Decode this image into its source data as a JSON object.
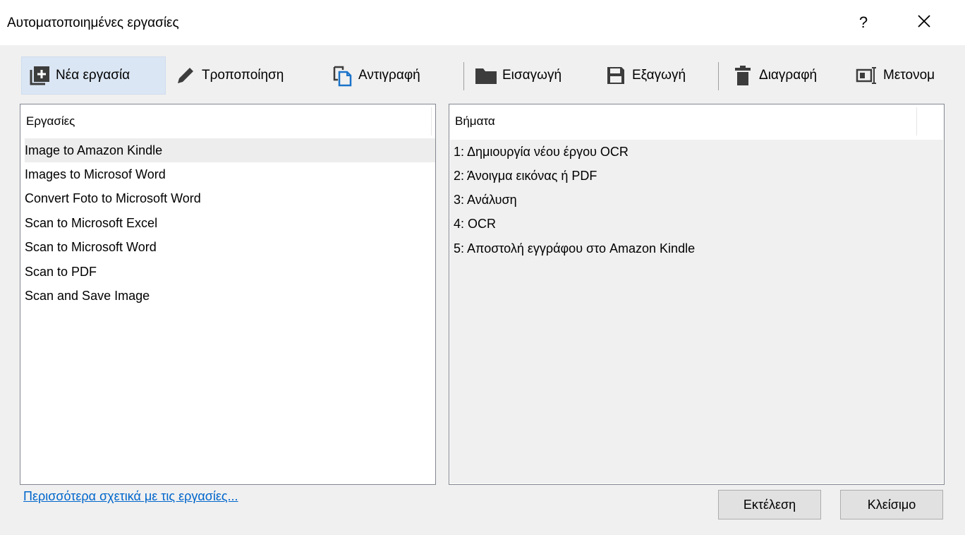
{
  "window": {
    "title": "Αυτοματοποιημένες εργασίες",
    "help_label": "?",
    "close_label": "✕"
  },
  "toolbar": {
    "new_task": "Νέα εργασία",
    "modify": "Τροποποίηση",
    "copy": "Αντιγραφή",
    "import": "Εισαγωγή",
    "export": "Εξαγωγή",
    "delete": "Διαγραφή",
    "rename": "Μετονομ"
  },
  "tasks": {
    "header": "Εργασίες",
    "items": [
      "Image to Amazon Kindle",
      "Images to Microsof Word",
      "Convert Foto to Microsoft Word",
      "Scan to Microsoft Excel",
      "Scan to Microsoft Word",
      "Scan to PDF",
      "Scan and Save Image"
    ],
    "selected_index": 0
  },
  "steps": {
    "header": "Βήματα",
    "items": [
      "1: Δημιουργία νέου έργου OCR",
      "2: Άνοιγμα εικόνας ή PDF",
      "3: Ανάλυση",
      "4: OCR",
      "5: Αποστολή εγγράφου στο Amazon Kindle"
    ]
  },
  "footer": {
    "more_link": "Περισσότερα σχετικά με τις εργασίες...",
    "run_button": "Εκτέλεση",
    "close_button": "Κλείσιμο"
  },
  "colors": {
    "active_toolbar_bg": "#dbe6f4",
    "link": "#0066cc",
    "icon": "#3c3c3c",
    "copy_icon_accent": "#1a73c9"
  },
  "icons": {
    "new_task": "add-square-icon",
    "modify": "pencil-icon",
    "copy": "copy-icon",
    "import": "folder-icon",
    "export": "save-icon",
    "delete": "trash-icon",
    "rename": "rename-icon"
  }
}
